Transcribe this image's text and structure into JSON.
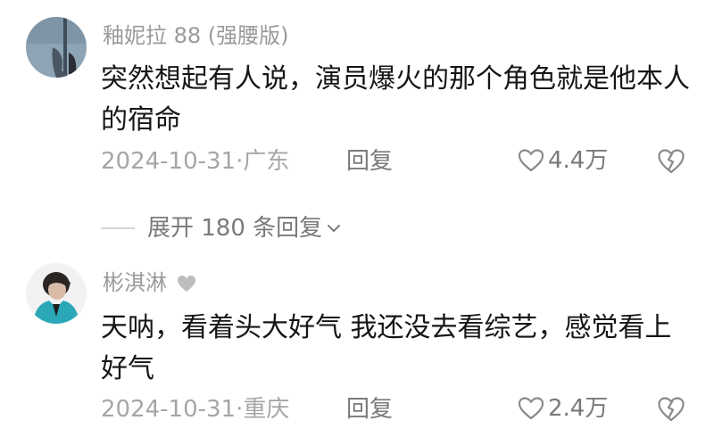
{
  "comments": [
    {
      "username": "釉妮拉 88 (强腰版)",
      "text": "突然想起有人说，演员爆火的那个角色就是他本人的宿命",
      "date_location": "2024-10-31·广东",
      "reply_label": "回复",
      "likes": "4.4万",
      "expand_label": "展开 180 条回复"
    },
    {
      "username": "彬淇淋",
      "text": "天呐，看着头大好气 我还没去看综艺，感觉看上好气",
      "date_location": "2024-10-31·重庆",
      "reply_label": "回复",
      "likes": "2.4万"
    }
  ],
  "icons": {
    "like": "heart-outline-icon",
    "dislike": "broken-heart-icon",
    "expand": "chevron-down-icon",
    "user_badge": "heart-badge-icon"
  },
  "colors": {
    "text": "#161616",
    "meta": "#a6a6a6",
    "action": "#7a7a7a"
  }
}
